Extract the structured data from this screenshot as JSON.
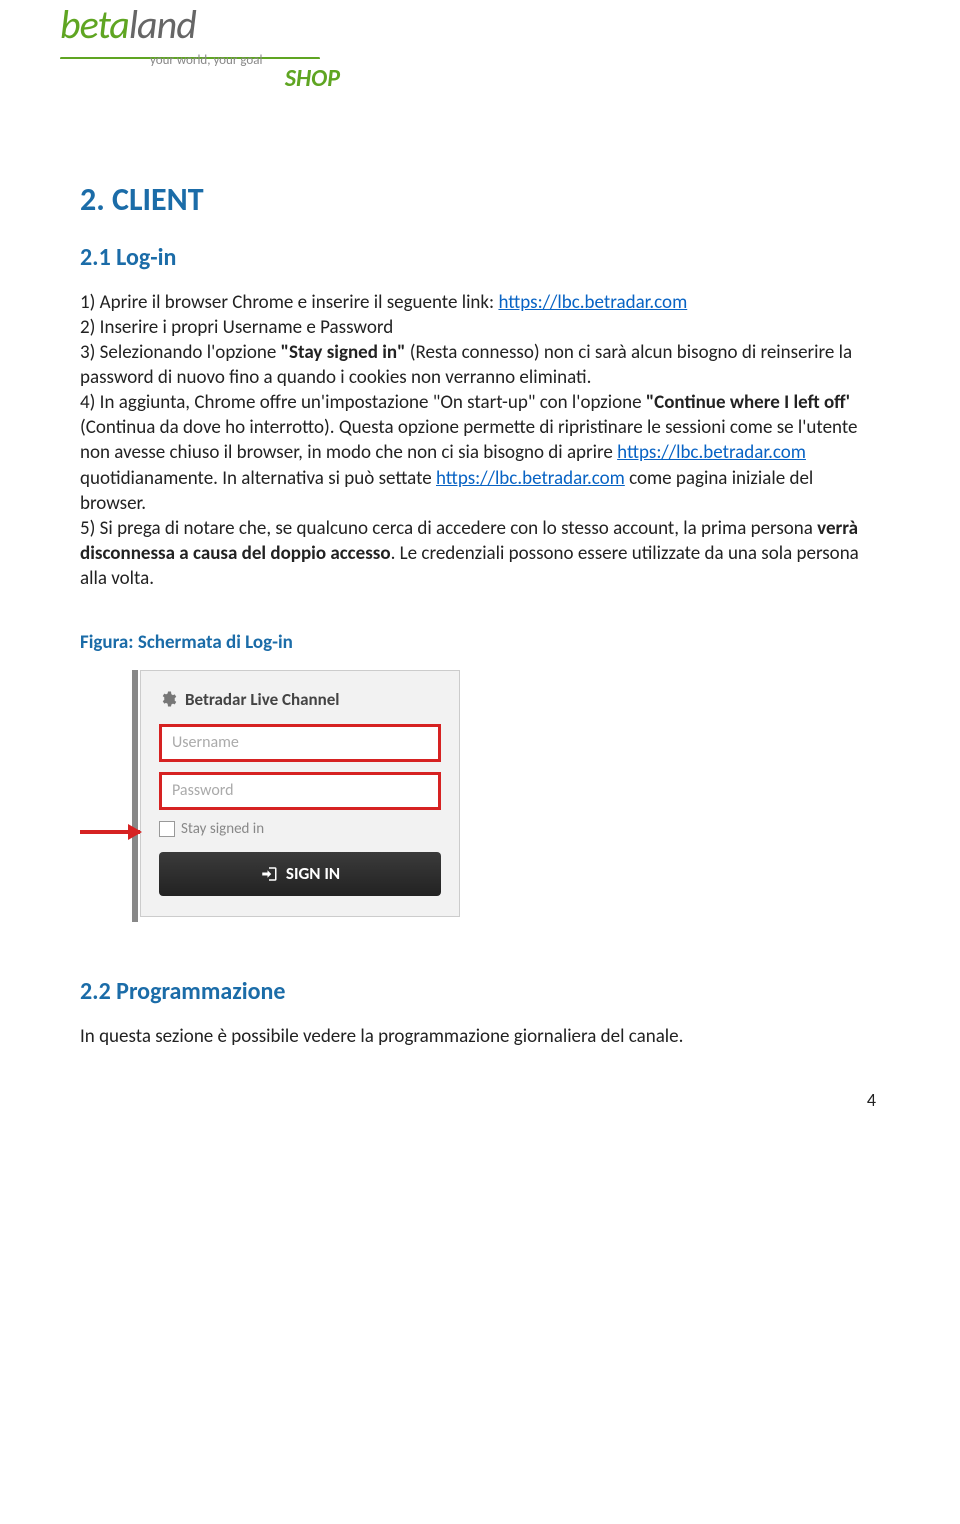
{
  "logo": {
    "part1": "beta",
    "part2": "land",
    "tagline": "your world, your goal",
    "shop": "SHOP"
  },
  "h1": "2. CLIENT",
  "h2_login": "2.1 Log-in",
  "para": {
    "p1a": "1) Aprire il browser Chrome e inserire il seguente link: ",
    "link1": "https://lbc.betradar.com",
    "p2a": "2) Inserire i propri Username e Password",
    "p3a": "3) Selezionando l'opzione ",
    "p3b": "\"Stay signed in\"",
    "p3c": " (Resta connesso) non ci sarà alcun bisogno di reinserire la password di nuovo fino a quando i cookies non verranno eliminati.",
    "p4a": "4) In aggiunta, Chrome offre un'impostazione \"On start-up\" con l'opzione ",
    "p4b": "\"Continue where I left off'",
    "p4c": " (Continua da dove ho interrotto). Questa opzione permette di ripristinare le sessioni come se l'utente non avesse chiuso il browser, in modo che non ci sia bisogno di aprire ",
    "link2": "https://lbc.betradar.com",
    "p4d": " quotidianamente. In alternativa si può settate ",
    "link3": "https://lbc.betradar.com",
    "p4e": " come pagina iniziale del browser.",
    "p5a": "5) Si prega di notare che, se qualcuno cerca di accedere con lo stesso account, la prima persona ",
    "p5b": "verrà disconnessa a causa del doppio accesso",
    "p5c": ". Le credenziali possono essere utilizzate da una sola persona alla volta."
  },
  "figure_label": "Figura: Schermata di Log-in",
  "login": {
    "title": "Betradar Live Channel",
    "username_ph": "Username",
    "password_ph": "Password",
    "stay": "Stay signed in",
    "signin": "SIGN IN"
  },
  "h2_prog": "2.2 Programmazione",
  "prog_text": "In questa sezione è possibile vedere la programmazione giornaliera del canale.",
  "page_number": "4"
}
